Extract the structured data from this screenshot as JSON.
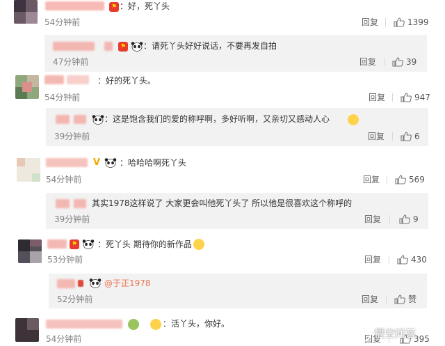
{
  "comments": [
    {
      "text": "：好，死丫头",
      "time": "54分钟前",
      "reply": "回复",
      "likes": "1399"
    },
    {
      "text": "：请死丫头好好说话，不要再发自拍",
      "time": "47分钟前",
      "reply": "回复",
      "likes": "39"
    },
    {
      "text": "：好的死丫头。",
      "time": "54分钟前",
      "reply": "回复",
      "likes": "947"
    },
    {
      "text": "：这是饱含我们的爱的称呼啊，多好听啊，又亲切又感动人心",
      "time": "39分钟前",
      "reply": "回复",
      "likes": "6"
    },
    {
      "text": "：哈哈哈啊死丫头",
      "time": "54分钟前",
      "reply": "回复",
      "likes": "569"
    },
    {
      "text": "其实1978这样说了 大家更会叫他死丫头了 所以他是很喜欢这个称呼的",
      "time": "39分钟前",
      "reply": "回复",
      "likes": "9"
    },
    {
      "text": "：死丫头 期待你的新作品",
      "time": "53分钟前",
      "reply": "回复",
      "likes": "430"
    },
    {
      "mention": "@于正1978",
      "time": "52分钟前",
      "reply": "回复",
      "likes": "赞"
    },
    {
      "text": "：活丫头，你好。",
      "time": "54分钟前",
      "reply": "回复",
      "likes": "395"
    }
  ],
  "badge_text": "V",
  "watermark": "悟空问答",
  "colors": {
    "accent": "#eb7350",
    "badge": "#e83b2c",
    "vip": "#f7a600",
    "box": "#f2f2f2"
  }
}
